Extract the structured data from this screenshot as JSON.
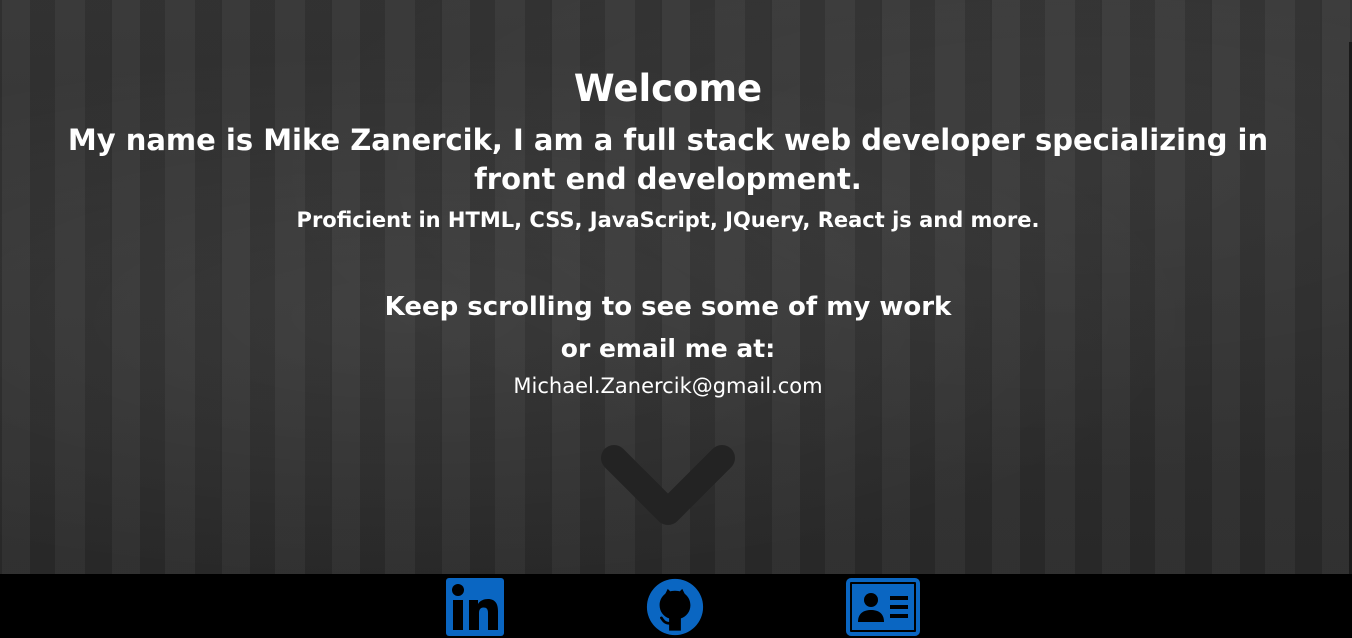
{
  "hero": {
    "title": "Welcome",
    "intro": "My name is Mike Zanercik, I am a full stack web developer specializing in front end development.",
    "skills": "Proficient in HTML, CSS, JavaScript, JQuery, React js and more.",
    "scroll_prompt": "Keep scrolling to see some of my work",
    "email_prompt": "or email me at:",
    "email": "Michael.Zanercik@gmail.com",
    "scroll_icon": "chevron-down-icon"
  },
  "footer": {
    "links": [
      {
        "icon": "linkedin-icon",
        "color": "#0a66c2"
      },
      {
        "icon": "github-icon",
        "color": "#0a66c2"
      },
      {
        "icon": "contact-card-icon",
        "color": "#0a66c2"
      }
    ]
  },
  "colors": {
    "background": "#2f2f2f",
    "text": "#ffffff",
    "footer": "#000000",
    "icon_blue": "#0a66c2",
    "chevron": "#232323"
  }
}
